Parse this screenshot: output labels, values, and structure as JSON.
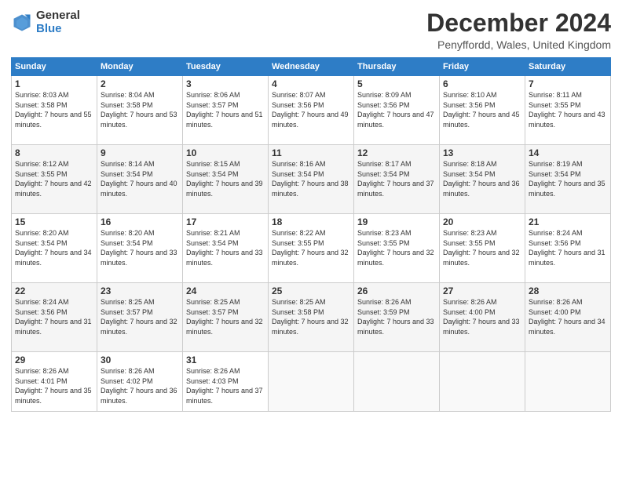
{
  "header": {
    "logo_general": "General",
    "logo_blue": "Blue",
    "title": "December 2024",
    "subtitle": "Penyffordd, Wales, United Kingdom"
  },
  "calendar": {
    "headers": [
      "Sunday",
      "Monday",
      "Tuesday",
      "Wednesday",
      "Thursday",
      "Friday",
      "Saturday"
    ],
    "rows": [
      [
        {
          "day": "1",
          "sunrise": "8:03 AM",
          "sunset": "3:58 PM",
          "daylight": "7 hours and 55 minutes."
        },
        {
          "day": "2",
          "sunrise": "8:04 AM",
          "sunset": "3:58 PM",
          "daylight": "7 hours and 53 minutes."
        },
        {
          "day": "3",
          "sunrise": "8:06 AM",
          "sunset": "3:57 PM",
          "daylight": "7 hours and 51 minutes."
        },
        {
          "day": "4",
          "sunrise": "8:07 AM",
          "sunset": "3:56 PM",
          "daylight": "7 hours and 49 minutes."
        },
        {
          "day": "5",
          "sunrise": "8:09 AM",
          "sunset": "3:56 PM",
          "daylight": "7 hours and 47 minutes."
        },
        {
          "day": "6",
          "sunrise": "8:10 AM",
          "sunset": "3:56 PM",
          "daylight": "7 hours and 45 minutes."
        },
        {
          "day": "7",
          "sunrise": "8:11 AM",
          "sunset": "3:55 PM",
          "daylight": "7 hours and 43 minutes."
        }
      ],
      [
        {
          "day": "8",
          "sunrise": "8:12 AM",
          "sunset": "3:55 PM",
          "daylight": "7 hours and 42 minutes."
        },
        {
          "day": "9",
          "sunrise": "8:14 AM",
          "sunset": "3:54 PM",
          "daylight": "7 hours and 40 minutes."
        },
        {
          "day": "10",
          "sunrise": "8:15 AM",
          "sunset": "3:54 PM",
          "daylight": "7 hours and 39 minutes."
        },
        {
          "day": "11",
          "sunrise": "8:16 AM",
          "sunset": "3:54 PM",
          "daylight": "7 hours and 38 minutes."
        },
        {
          "day": "12",
          "sunrise": "8:17 AM",
          "sunset": "3:54 PM",
          "daylight": "7 hours and 37 minutes."
        },
        {
          "day": "13",
          "sunrise": "8:18 AM",
          "sunset": "3:54 PM",
          "daylight": "7 hours and 36 minutes."
        },
        {
          "day": "14",
          "sunrise": "8:19 AM",
          "sunset": "3:54 PM",
          "daylight": "7 hours and 35 minutes."
        }
      ],
      [
        {
          "day": "15",
          "sunrise": "8:20 AM",
          "sunset": "3:54 PM",
          "daylight": "7 hours and 34 minutes."
        },
        {
          "day": "16",
          "sunrise": "8:20 AM",
          "sunset": "3:54 PM",
          "daylight": "7 hours and 33 minutes."
        },
        {
          "day": "17",
          "sunrise": "8:21 AM",
          "sunset": "3:54 PM",
          "daylight": "7 hours and 33 minutes."
        },
        {
          "day": "18",
          "sunrise": "8:22 AM",
          "sunset": "3:55 PM",
          "daylight": "7 hours and 32 minutes."
        },
        {
          "day": "19",
          "sunrise": "8:23 AM",
          "sunset": "3:55 PM",
          "daylight": "7 hours and 32 minutes."
        },
        {
          "day": "20",
          "sunrise": "8:23 AM",
          "sunset": "3:55 PM",
          "daylight": "7 hours and 32 minutes."
        },
        {
          "day": "21",
          "sunrise": "8:24 AM",
          "sunset": "3:56 PM",
          "daylight": "7 hours and 31 minutes."
        }
      ],
      [
        {
          "day": "22",
          "sunrise": "8:24 AM",
          "sunset": "3:56 PM",
          "daylight": "7 hours and 31 minutes."
        },
        {
          "day": "23",
          "sunrise": "8:25 AM",
          "sunset": "3:57 PM",
          "daylight": "7 hours and 32 minutes."
        },
        {
          "day": "24",
          "sunrise": "8:25 AM",
          "sunset": "3:57 PM",
          "daylight": "7 hours and 32 minutes."
        },
        {
          "day": "25",
          "sunrise": "8:25 AM",
          "sunset": "3:58 PM",
          "daylight": "7 hours and 32 minutes."
        },
        {
          "day": "26",
          "sunrise": "8:26 AM",
          "sunset": "3:59 PM",
          "daylight": "7 hours and 33 minutes."
        },
        {
          "day": "27",
          "sunrise": "8:26 AM",
          "sunset": "4:00 PM",
          "daylight": "7 hours and 33 minutes."
        },
        {
          "day": "28",
          "sunrise": "8:26 AM",
          "sunset": "4:00 PM",
          "daylight": "7 hours and 34 minutes."
        }
      ],
      [
        {
          "day": "29",
          "sunrise": "8:26 AM",
          "sunset": "4:01 PM",
          "daylight": "7 hours and 35 minutes."
        },
        {
          "day": "30",
          "sunrise": "8:26 AM",
          "sunset": "4:02 PM",
          "daylight": "7 hours and 36 minutes."
        },
        {
          "day": "31",
          "sunrise": "8:26 AM",
          "sunset": "4:03 PM",
          "daylight": "7 hours and 37 minutes."
        },
        null,
        null,
        null,
        null
      ]
    ]
  }
}
